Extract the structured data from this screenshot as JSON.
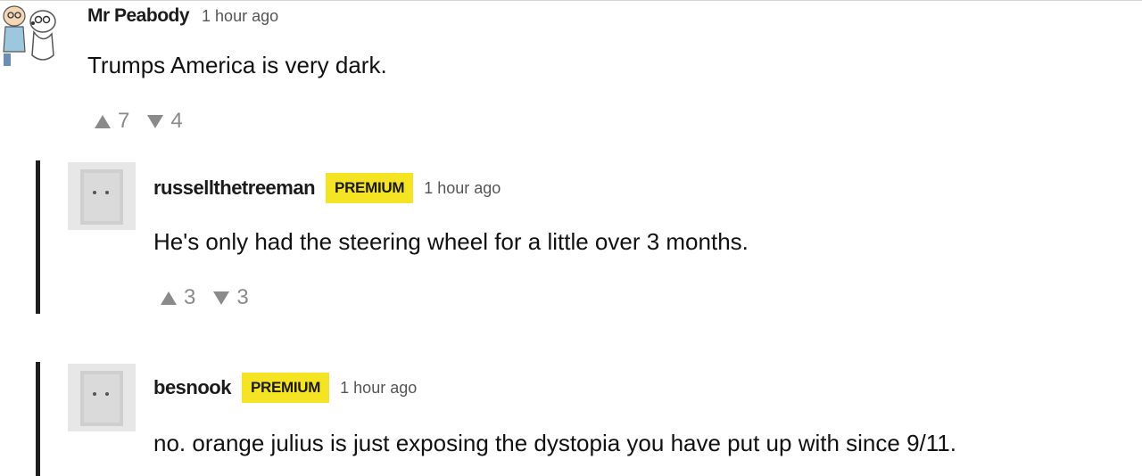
{
  "comments": [
    {
      "username": "Mr Peabody",
      "time": "1 hour ago",
      "text": "Trumps America is very dark.",
      "upvotes": "7",
      "downvotes": "4",
      "replies": [
        {
          "username": "russellthetreeman",
          "badge": "PREMIUM",
          "time": "1 hour ago",
          "text": "He's only had the steering wheel for a little over 3 months.",
          "upvotes": "3",
          "downvotes": "3"
        },
        {
          "username": "besnook",
          "badge": "PREMIUM",
          "time": "1 hour ago",
          "text": "no. orange julius is just exposing the dystopia you have put up with since 9/11."
        }
      ]
    }
  ],
  "colors": {
    "badge_bg": "#f5e424",
    "reply_bar": "#1e1e1e",
    "vote_gray": "#8a8a8a"
  },
  "icons": {
    "upvote": "triangle-up",
    "downvote": "triangle-down"
  }
}
